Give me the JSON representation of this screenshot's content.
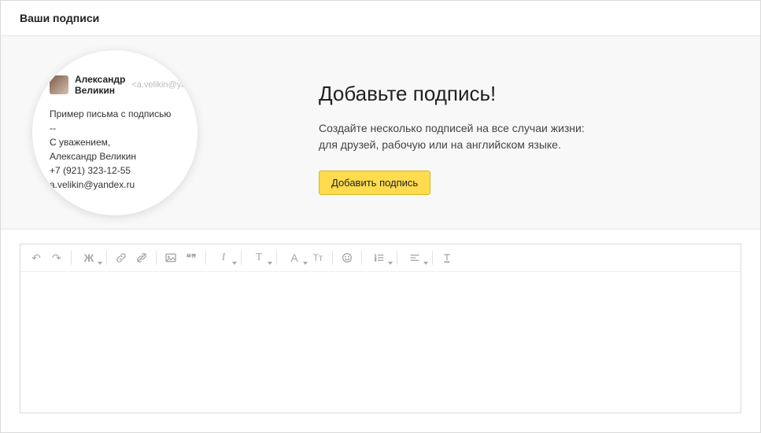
{
  "header": {
    "title": "Ваши подписи"
  },
  "preview": {
    "sender_name": "Александр Великин",
    "sender_email": "<a.velikin@yandex.ru>",
    "body_intro": "Пример письма с подписью",
    "sig_sep": "--",
    "sig_regards": "С уважением,",
    "sig_name": "Александр Великин",
    "sig_phone": "+7 (921) 323-12-55",
    "sig_email": "a.velikin@yandex.ru"
  },
  "cta": {
    "title": "Добавьте подпись!",
    "line1": "Создайте несколько подписей на все случаи жизни:",
    "line2": "для друзей, рабочую или на английском языке.",
    "button": "Добавить подпись"
  },
  "toolbar": {
    "undo": "↶",
    "redo": "↷",
    "bold_label": "Ж",
    "italic_label": "I",
    "text_label": "T",
    "font_a": "A",
    "tt_label": "Tт",
    "quote": "❝❞"
  }
}
